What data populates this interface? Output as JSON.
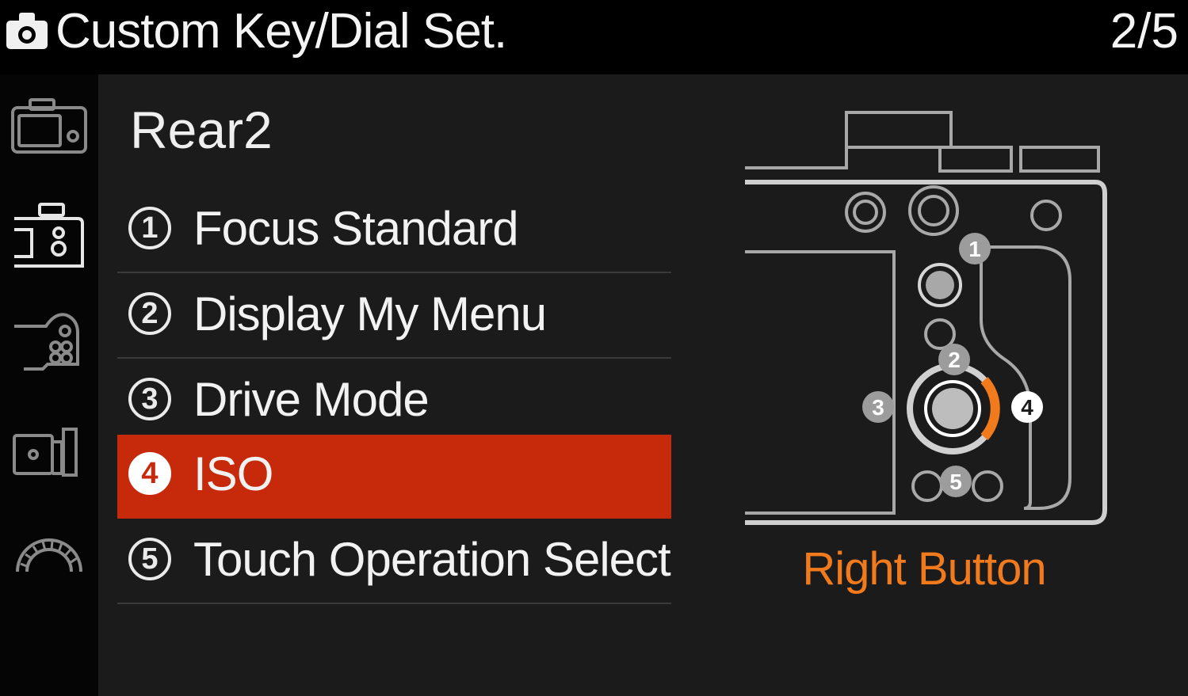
{
  "header": {
    "title": "Custom Key/Dial Set.",
    "page_indicator": "2/5",
    "icon": "camera-icon"
  },
  "sidebar": {
    "tabs": [
      {
        "icon": "camera-body-tab-icon"
      },
      {
        "icon": "camera-rear-tab-icon"
      },
      {
        "icon": "camera-buttons-tab-icon"
      },
      {
        "icon": "camera-side-tab-icon"
      },
      {
        "icon": "dial-tab-icon"
      }
    ]
  },
  "main": {
    "section_title": "Rear2",
    "items": [
      {
        "number": "1",
        "label": "Focus Standard",
        "selected": false
      },
      {
        "number": "2",
        "label": "Display My Menu",
        "selected": false
      },
      {
        "number": "3",
        "label": "Drive Mode",
        "selected": false
      },
      {
        "number": "4",
        "label": "ISO",
        "selected": true
      },
      {
        "number": "5",
        "label": "Touch Operation Select",
        "selected": false
      }
    ],
    "diagram": {
      "markers": [
        "1",
        "2",
        "3",
        "4",
        "5"
      ],
      "highlight_color": "#f07a1c"
    },
    "caption": "Right Button"
  },
  "colors": {
    "selected_bg": "#c72a0a",
    "accent": "#f07a1c",
    "panel_bg": "#1b1b1b"
  }
}
